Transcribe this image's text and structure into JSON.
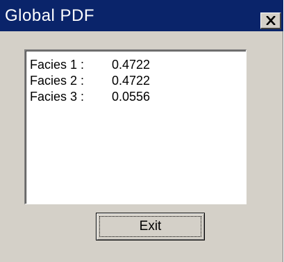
{
  "window": {
    "title": "Global PDF",
    "close_icon": "close-icon"
  },
  "list": {
    "items": [
      {
        "label": "Facies 1 :",
        "value": "0.4722"
      },
      {
        "label": "Facies 2 :",
        "value": "0.4722"
      },
      {
        "label": "Facies 3 :",
        "value": "0.0556"
      }
    ]
  },
  "buttons": {
    "exit_label": "Exit"
  },
  "colors": {
    "title_bar": "#0a246a",
    "face": "#d4d0c8",
    "list_background": "#ffffff"
  }
}
